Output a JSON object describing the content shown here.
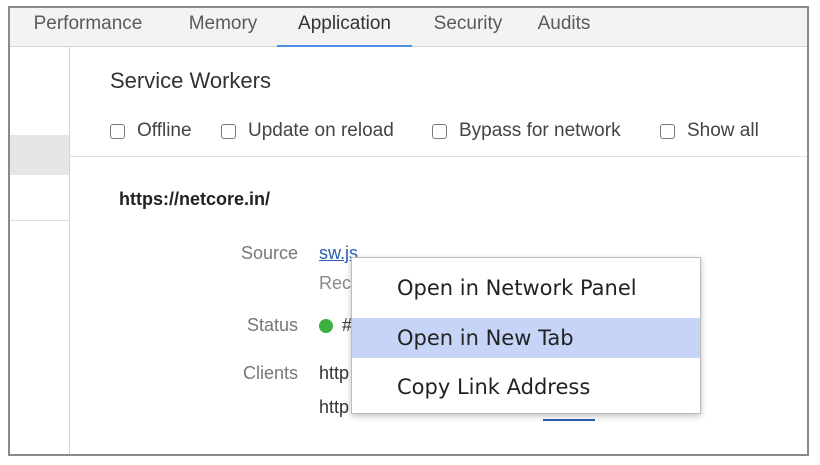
{
  "tabs": [
    {
      "label": "Performance",
      "active": false
    },
    {
      "label": "Memory",
      "active": false
    },
    {
      "label": "Application",
      "active": true
    },
    {
      "label": "Security",
      "active": false
    },
    {
      "label": "Audits",
      "active": false
    }
  ],
  "panel": {
    "title": "Service Workers",
    "options": [
      {
        "label": "Offline",
        "checked": false
      },
      {
        "label": "Update on reload",
        "checked": false
      },
      {
        "label": "Bypass for network",
        "checked": false
      },
      {
        "label": "Show all",
        "checked": false
      }
    ]
  },
  "worker": {
    "origin": "https://netcore.in/",
    "source_label": "Source",
    "source_link": "sw.js",
    "received_fragment": "Rec",
    "status_label": "Status",
    "status_fragment": "#",
    "status_color": "#3cb043",
    "clients_label": "Clients",
    "client_fragments": [
      "http",
      "http"
    ]
  },
  "context_menu": {
    "items": [
      {
        "label": "Open in Network Panel",
        "highlighted": false
      },
      {
        "label": "Open in New Tab",
        "highlighted": true
      },
      {
        "label": "Copy Link Address",
        "highlighted": false
      }
    ],
    "highlight_color": "#c5d4f7"
  },
  "colors": {
    "tab_accent": "#4a90e2",
    "link": "#2a5db0"
  }
}
